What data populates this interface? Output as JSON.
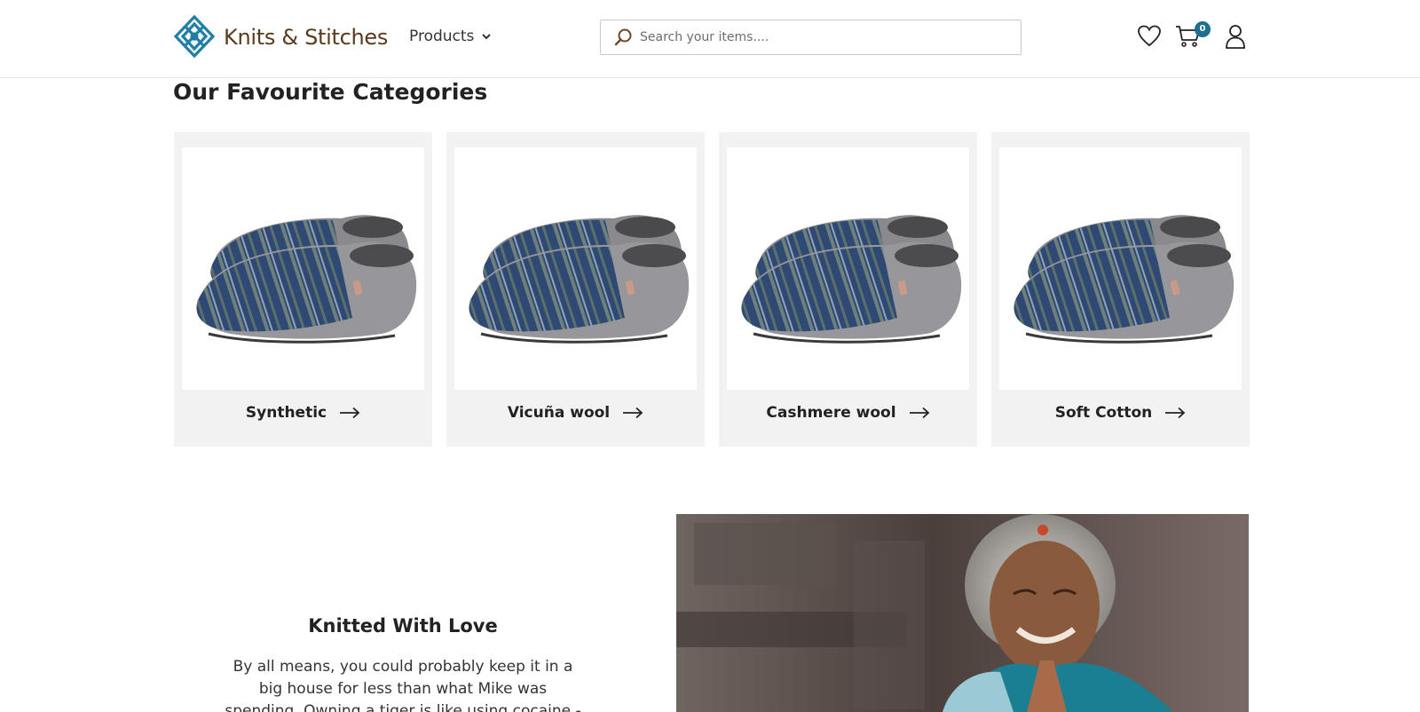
{
  "brand": {
    "name": "Knits & Stitches"
  },
  "nav": {
    "products_label": "Products"
  },
  "search": {
    "placeholder": "Search your items...."
  },
  "cart": {
    "count": "0"
  },
  "icons": {
    "logo": "knot-logo-icon",
    "search": "search-icon",
    "wishlist": "heart-icon",
    "cart": "cart-icon",
    "account": "user-icon",
    "dropdown": "chevron-down-icon",
    "card_arrow": "arrow-right-icon"
  },
  "categories_section": {
    "title": "Our Favourite Categories",
    "items": [
      {
        "label": "Synthetic"
      },
      {
        "label": "Vicuña wool"
      },
      {
        "label": "Cashmere wool"
      },
      {
        "label": "Soft Cotton"
      }
    ]
  },
  "feature": {
    "title": "Knitted With Love",
    "text": "By all means, you could probably keep it in a big house for less than what Mike was spending. Owning a tiger is like using cocaine - it's God's way"
  },
  "colors": {
    "brand_brown": "#5a3a1c",
    "brand_teal": "#1e6f8f",
    "card_bg": "#f2f2f2"
  }
}
